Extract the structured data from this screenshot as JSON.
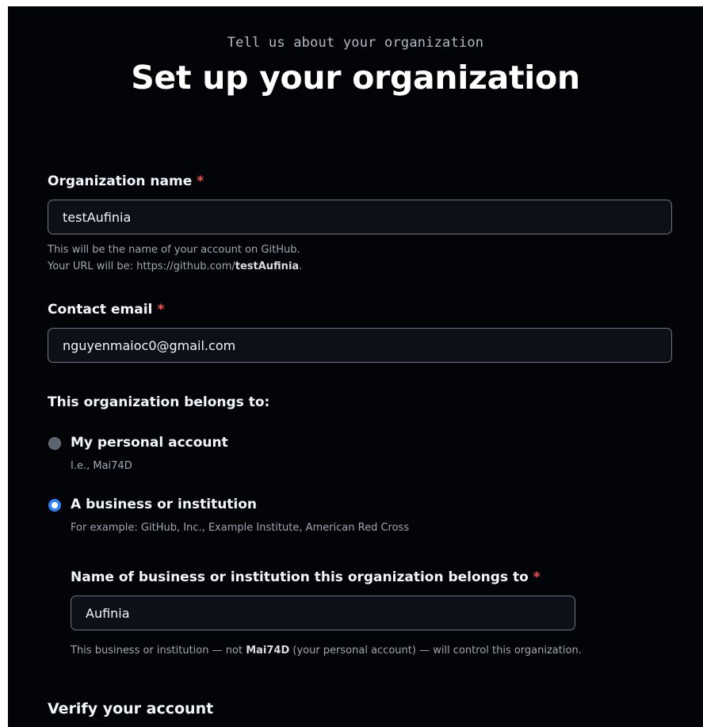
{
  "header": {
    "eyebrow": "Tell us about your organization",
    "title": "Set up your organization"
  },
  "org_name": {
    "label": "Organization name",
    "required_mark": "*",
    "value": "testAufinia",
    "help_line1": "This will be the name of your account on GitHub.",
    "help_line2_prefix": "Your URL will be: https://github.com/",
    "help_line2_name": "testAufinia",
    "help_line2_suffix": "."
  },
  "contact_email": {
    "label": "Contact email",
    "required_mark": "*",
    "value": "nguyenmaioc0@gmail.com"
  },
  "belongs_to": {
    "label": "This organization belongs to:",
    "options": [
      {
        "label": "My personal account",
        "description": "I.e., Mai74D",
        "selected": false
      },
      {
        "label": "A business or institution",
        "description": "For example: GitHub, Inc., Example Institute, American Red Cross",
        "selected": true
      }
    ]
  },
  "business_name": {
    "label": "Name of business or institution this organization belongs to",
    "required_mark": "*",
    "value": "Aufinia",
    "help_prefix": "This business or institution — not ",
    "help_account": "Mai74D",
    "help_suffix": " (your personal account) — will control this organization."
  },
  "verify": {
    "heading": "Verify your account"
  },
  "colors": {
    "background": "#030407",
    "accent": "#2f81f7",
    "required": "#f85149",
    "input_border": "#6e7681"
  }
}
